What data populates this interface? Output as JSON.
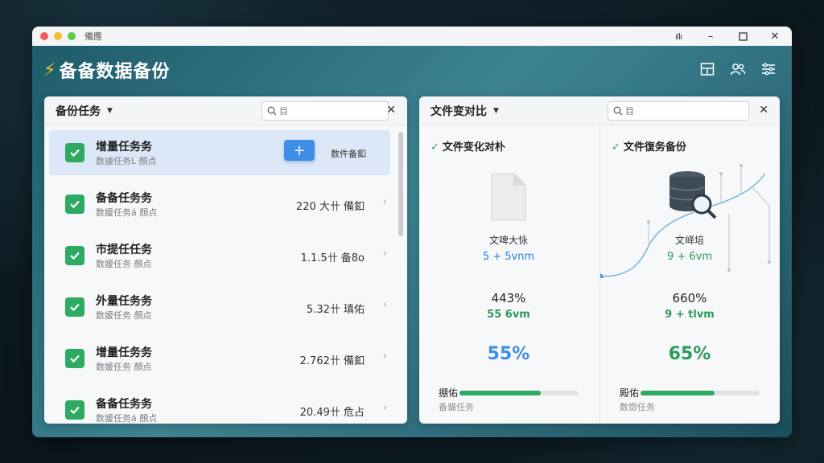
{
  "window": {
    "title": "備應"
  },
  "app": {
    "title": "备备数据备份"
  },
  "left_panel": {
    "title": "备份任务",
    "search_text": "目",
    "tasks": [
      {
        "name": "增量任务务",
        "sub": "数據任务L 顏点",
        "right": "数件备釦",
        "selected": true
      },
      {
        "name": "备备任务务",
        "sub": "数媛任务á 顏点",
        "right": "220 大卄 備釦",
        "selected": false
      },
      {
        "name": "市提任任务",
        "sub": "数媛任务 顏点",
        "right": "1.1.5卄 备8o",
        "selected": false
      },
      {
        "name": "外量任务务",
        "sub": "数媛任务 顏点",
        "right": "5.32卄 瑱佑",
        "selected": false
      },
      {
        "name": "增量任务务",
        "sub": "数媛任务 顏点",
        "right": "2.762卄 備釦",
        "selected": false
      },
      {
        "name": "备备任务务",
        "sub": "数媛任务á 顏点",
        "right": "20.49卄 危占",
        "selected": false
      }
    ]
  },
  "right_panel": {
    "title": "文件变对比",
    "search_text": "目",
    "col_a": {
      "title": "文件变化对朴",
      "file_label": "文啤大怺",
      "file_stat": "5 + 5vnm",
      "pct": "443%",
      "delta": "55 6vm",
      "big_pct": "55%",
      "bottom_label": "掤佑",
      "bottom_sub": "备貓任务",
      "progress": 0.68
    },
    "col_b": {
      "title": "文件復务备份",
      "file_label": "文峄培",
      "file_stat": "9 + 6vm",
      "pct": "660%",
      "delta": "9 + tlvm",
      "big_pct": "65%",
      "bottom_label": "殿佑",
      "bottom_sub": "数惚任务",
      "progress": 0.62
    }
  },
  "colors": {
    "accent_green": "#2eaa62",
    "accent_blue": "#3e8ee8",
    "selected_row": "#dce8f8"
  }
}
